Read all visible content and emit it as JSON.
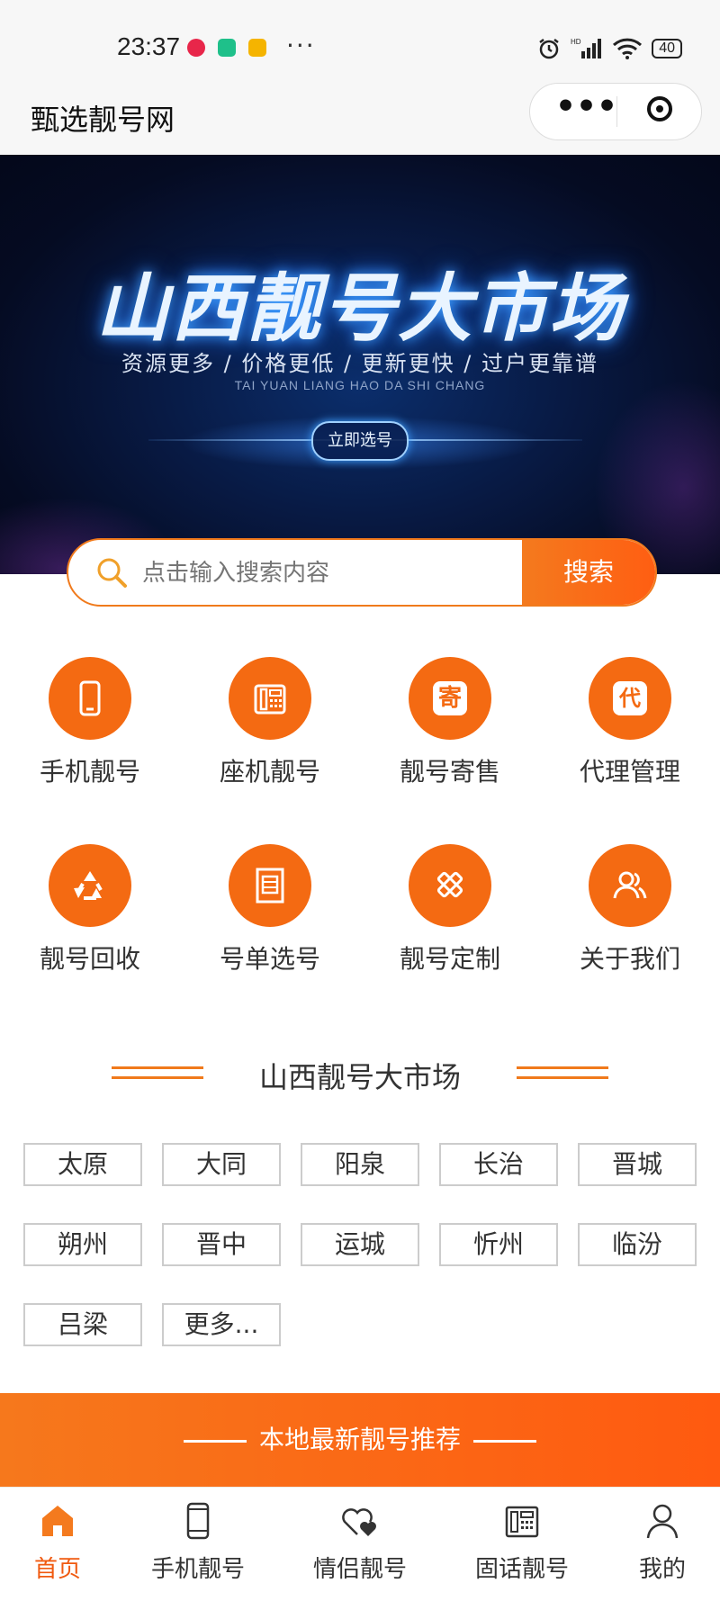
{
  "status_bar": {
    "time": "23:37",
    "battery": "40",
    "icons": [
      "video-app-icon",
      "shield-app-icon",
      "weibo-app-icon",
      "more-dots-icon",
      "alarm-icon",
      "signal-icon",
      "wifi-icon",
      "battery-icon"
    ]
  },
  "app": {
    "title": "甄选靓号网",
    "capsule_more": "•••"
  },
  "banner": {
    "title": "山西靓号大市场",
    "subtitle": "资源更多 / 价格更低 / 更新更快 / 过户更靠谱",
    "pinyin": "TAI YUAN LIANG HAO DA SHI CHANG",
    "button": "立即选号"
  },
  "search": {
    "placeholder": "点击输入搜索内容",
    "button": "搜索"
  },
  "menu": [
    {
      "label": "手机靓号",
      "icon": "mobile-phone-icon"
    },
    {
      "label": "座机靓号",
      "icon": "landline-phone-icon"
    },
    {
      "label": "靓号寄售",
      "icon": "consign-icon",
      "glyph": "寄"
    },
    {
      "label": "代理管理",
      "icon": "agent-icon",
      "glyph": "代"
    },
    {
      "label": "靓号回收",
      "icon": "recycle-icon"
    },
    {
      "label": "号单选号",
      "icon": "number-list-icon"
    },
    {
      "label": "靓号定制",
      "icon": "customize-icon"
    },
    {
      "label": "关于我们",
      "icon": "about-us-icon"
    }
  ],
  "section": {
    "title": "山西靓号大市场"
  },
  "cities": [
    "太原",
    "大同",
    "阳泉",
    "长治",
    "晋城",
    "朔州",
    "晋中",
    "运城",
    "忻州",
    "临汾",
    "吕梁",
    "更多..."
  ],
  "recommend": {
    "label": "本地最新靓号推荐"
  },
  "tabbar": [
    {
      "label": "首页",
      "icon": "home-icon",
      "active": true
    },
    {
      "label": "手机靓号",
      "icon": "mobile-phone-icon",
      "active": false
    },
    {
      "label": "情侣靓号",
      "icon": "couple-heart-icon",
      "active": false
    },
    {
      "label": "固话靓号",
      "icon": "landline-phone-icon",
      "active": false
    },
    {
      "label": "我的",
      "icon": "user-icon",
      "active": false
    }
  ],
  "colors": {
    "accent": "#f46a12",
    "active_tab": "#f05a10",
    "banner_bg": "#081a44"
  }
}
